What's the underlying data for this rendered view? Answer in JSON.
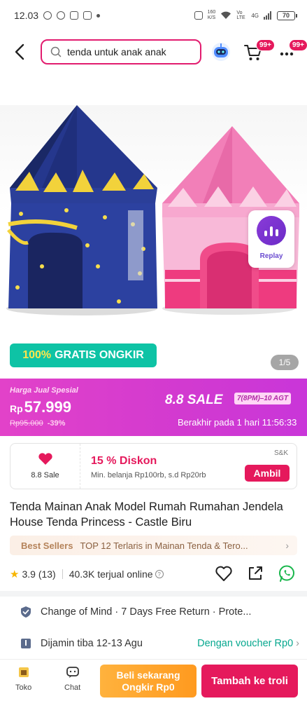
{
  "status_bar": {
    "time": "12.03",
    "net_speed_value": "160",
    "net_speed_unit": "K/S",
    "volte": "Vo LTE",
    "signal": "4G",
    "battery": "70"
  },
  "header": {
    "search_value": "tenda untuk anak anak",
    "cart_badge": "99+",
    "more_badge": "99+"
  },
  "hero": {
    "replay_label": "Replay",
    "free_shipping_highlight": "100%",
    "free_shipping_text": "GRATIS ONGKIR",
    "pager": "1/5"
  },
  "sale": {
    "special_label": "Harga Jual Spesial",
    "currency": "Rp",
    "price": "57.999",
    "old_price": "Rp95.000",
    "discount": "-39%",
    "event": "8.8 SALE",
    "event_time": "7(8PM)–10 AGT",
    "ends_text": "Berakhir pada 1 hari 11:56:33"
  },
  "coupon": {
    "badge_label": "8.8 Sale",
    "title": "15 % Diskon",
    "description": "Min. belanja Rp100rb, s.d Rp20rb",
    "store_tag": "S&K",
    "claim_label": "Ambil"
  },
  "product": {
    "title": "Tenda Mainan Anak Model Rumah Rumahan Jendela House Tenda Princess - Castle Biru",
    "best_seller_tag": "Best Sellers",
    "best_seller_text": "TOP 12 Terlaris in Mainan Tenda & Tero...",
    "rating": "3.9",
    "rating_count": "(13)",
    "sold": "40.3K terjual online"
  },
  "info": {
    "return_text": "Change of Mind  ·  7 Days Free Return  ·  Prote...",
    "delivery_text": "Dijamin tiba 12-13 Agu",
    "voucher_text": "Dengan voucher Rp0"
  },
  "bottom_bar": {
    "store_label": "Toko",
    "chat_label": "Chat",
    "buy_line1": "Beli sekarang",
    "buy_line2": "Ongkir Rp0",
    "add_cart_label": "Tambah ke troli"
  },
  "colors": {
    "brand_pink": "#e5195c",
    "sale_magenta": "#d23ad0",
    "teal": "#0ec3a5",
    "orange": "#ff9a1f"
  }
}
